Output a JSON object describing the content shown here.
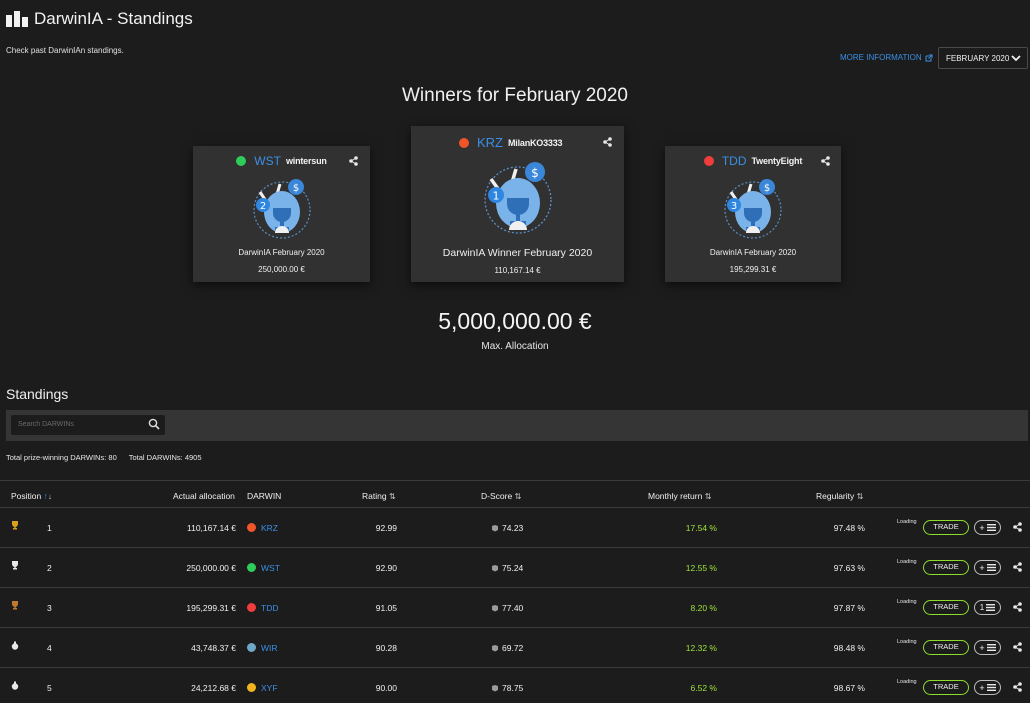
{
  "header": {
    "title": "DarwinIA - Standings",
    "subtitle": "Check past DarwinIAn standings.",
    "more_info": "MORE INFORMATION",
    "month_select": "FEBRUARY 2020"
  },
  "winners": {
    "title": "Winners for February 2020",
    "cards": [
      {
        "rank": "2",
        "ticker": "WST",
        "user": "wintersun",
        "name": "DarwinIA February 2020",
        "amount": "250,000.00 €",
        "dot_color": "#2ecc5a"
      },
      {
        "rank": "1",
        "ticker": "KRZ",
        "user": "MilanKO3333",
        "name": "DarwinIA Winner February 2020",
        "amount": "110,167.14 €",
        "dot_color": "#f0552a"
      },
      {
        "rank": "3",
        "ticker": "TDD",
        "user": "TwentyEight",
        "name": "DarwinIA February 2020",
        "amount": "195,299.31 €",
        "dot_color": "#ef3d3d"
      }
    ],
    "max_allocation": "5,000,000.00 €",
    "max_allocation_label": "Max. Allocation"
  },
  "standings": {
    "title": "Standings",
    "search_placeholder": "Search DARWINs",
    "total_prize": "Total prize-winning DARWINs: 80",
    "total_darwins": "Total DARWINs: 4905",
    "columns": {
      "position": "Position",
      "actual_allocation": "Actual allocation",
      "darwin": "DARWIN",
      "rating": "Rating",
      "dscore": "D-Score",
      "monthly_return": "Monthly return",
      "regularity": "Regularity"
    },
    "rows": [
      {
        "position": "1",
        "allocation": "110,167.14 €",
        "darwin": "KRZ",
        "dot_color": "#f0552a",
        "rating": "92.99",
        "dscore": "74.23",
        "monthly_return": "17.54 %",
        "regularity": "97.48 %",
        "loading": "Loading",
        "trade": "TRADE",
        "list_label": "",
        "icon": "gold-trophy-icon"
      },
      {
        "position": "2",
        "allocation": "250,000.00 €",
        "darwin": "WST",
        "dot_color": "#2ecc5a",
        "rating": "92.90",
        "dscore": "75.24",
        "monthly_return": "12.55 %",
        "regularity": "97.63 %",
        "loading": "Loading",
        "trade": "TRADE",
        "list_label": "",
        "icon": "silver-trophy-icon"
      },
      {
        "position": "3",
        "allocation": "195,299.31 €",
        "darwin": "TDD",
        "dot_color": "#ef3d3d",
        "rating": "91.05",
        "dscore": "77.40",
        "monthly_return": "8.20 %",
        "regularity": "97.87 %",
        "loading": "Loading",
        "trade": "TRADE",
        "list_label": "1",
        "icon": "bronze-trophy-icon"
      },
      {
        "position": "4",
        "allocation": "43,748.37 €",
        "darwin": "WIR",
        "dot_color": "#6fa7c6",
        "rating": "90.28",
        "dscore": "69.72",
        "monthly_return": "12.32 %",
        "regularity": "98.48 %",
        "loading": "Loading",
        "trade": "TRADE",
        "list_label": "",
        "icon": "prize-bag-icon"
      },
      {
        "position": "5",
        "allocation": "24,212.68 €",
        "darwin": "XYF",
        "dot_color": "#f2b41e",
        "rating": "90.00",
        "dscore": "78.75",
        "monthly_return": "6.52 %",
        "regularity": "98.67 %",
        "loading": "Loading",
        "trade": "TRADE",
        "list_label": "",
        "icon": "prize-bag-icon"
      }
    ]
  }
}
